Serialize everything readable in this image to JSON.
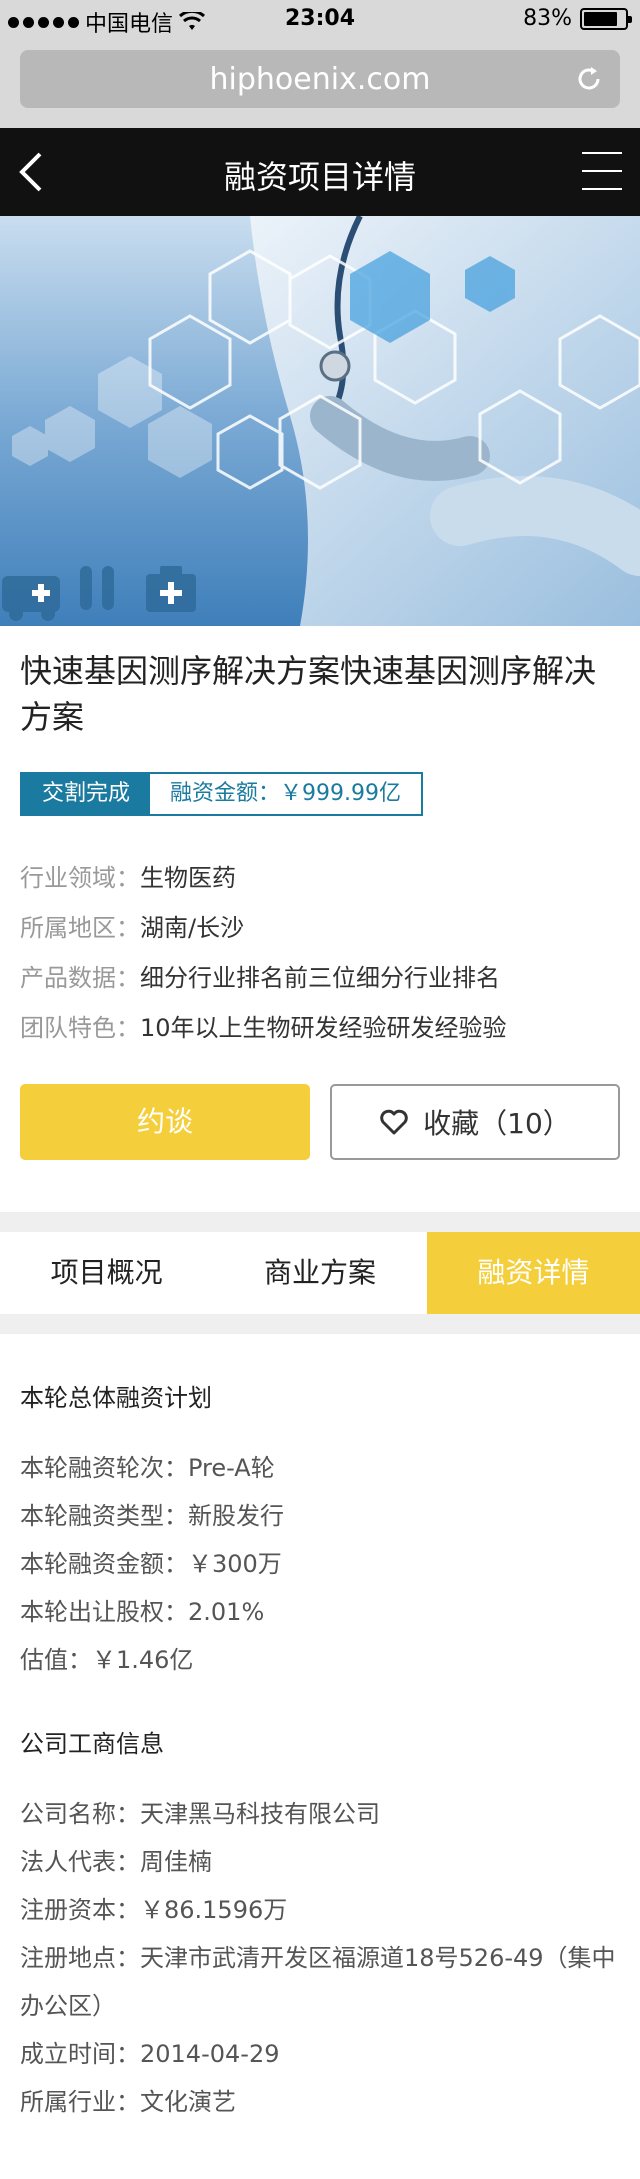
{
  "status_bar": {
    "carrier": "中国电信",
    "time": "23:04",
    "battery": "83%",
    "battery_level": 0.83
  },
  "browser": {
    "url": "hiphoenix.com"
  },
  "nav": {
    "title": "融资项目详情"
  },
  "project": {
    "title": "快速基因测序解决方案快速基因测序解决方案",
    "status_tag": "交割完成",
    "amount_tag": "融资金额：￥999.99亿",
    "info": [
      {
        "label": "行业领域：",
        "value": "生物医药"
      },
      {
        "label": "所属地区：",
        "value": "湖南/长沙"
      },
      {
        "label": "产品数据：",
        "value": "细分行业排名前三位细分行业排名"
      },
      {
        "label": "团队特色：",
        "value": "10年以上生物研发经验研发经验验"
      }
    ]
  },
  "actions": {
    "talk_label": "约谈",
    "favorite_label": "收藏（10）"
  },
  "tabs": [
    {
      "label": "项目概况"
    },
    {
      "label": "商业方案"
    },
    {
      "label": "融资详情"
    }
  ],
  "financing": {
    "title": "本轮总体融资计划",
    "lines": [
      {
        "label": "本轮融资轮次：",
        "value": "Pre-A轮"
      },
      {
        "label": "本轮融资类型：",
        "value": "新股发行"
      },
      {
        "label": "本轮融资金额：",
        "value": "￥300万"
      },
      {
        "label": "本轮出让股权：",
        "value": "2.01%"
      },
      {
        "label": "估值：",
        "value": "￥1.46亿"
      }
    ]
  },
  "company": {
    "title": "公司工商信息",
    "lines": [
      {
        "label": "公司名称：",
        "value": "天津黑马科技有限公司"
      },
      {
        "label": "法人代表：",
        "value": "周佳楠"
      },
      {
        "label": "注册资本：",
        "value": "￥86.1596万"
      },
      {
        "label": "注册地点：",
        "value": "天津市武清开发区福源道18号526-49（集中办公区）"
      },
      {
        "label": "成立时间：",
        "value": "2014-04-29"
      },
      {
        "label": "所属行业：",
        "value": "文化演艺"
      }
    ]
  }
}
